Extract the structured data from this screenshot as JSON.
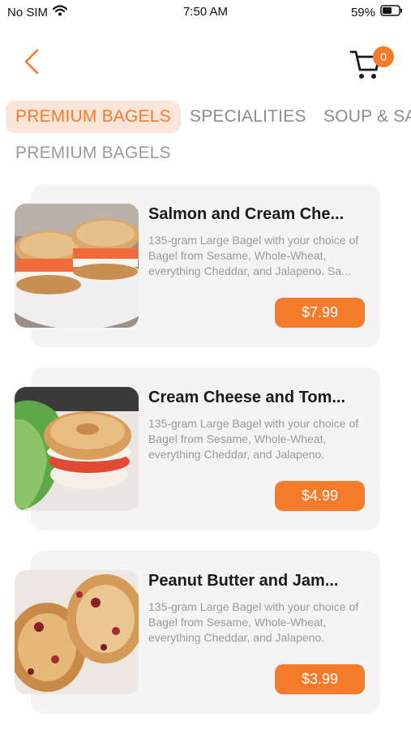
{
  "status_bar": {
    "carrier": "No SIM",
    "time": "7:50 AM",
    "battery": "59%"
  },
  "header": {
    "cart_count": "0"
  },
  "tabs": [
    {
      "label": "PREMIUM BAGELS",
      "active": true
    },
    {
      "label": "SPECIALITIES",
      "active": false
    },
    {
      "label": "SOUP & SA",
      "active": false
    }
  ],
  "section_title": "PREMIUM BAGELS",
  "items": [
    {
      "name": "Salmon and Cream Che...",
      "description": "135-gram Large Bagel with your choice of Bagel from Sesame, Whole-Wheat, everything Cheddar, and Jalapeno. Sa...",
      "price": "$7.99"
    },
    {
      "name": "Cream Cheese and Tom...",
      "description": "135-gram Large Bagel with your choice of Bagel from Sesame, Whole-Wheat, everything Cheddar, and Jalapeno.",
      "price": "$4.99"
    },
    {
      "name": "Peanut Butter and Jam...",
      "description": "135-gram Large Bagel with your choice of Bagel from Sesame, Whole-Wheat, everything Cheddar, and Jalapeno.",
      "price": "$3.99"
    }
  ],
  "colors": {
    "accent": "#f47b2a",
    "active_tab_bg": "#fbe5d9",
    "card_bg": "#f4f4f5"
  },
  "icons": [
    "wifi-icon",
    "battery-icon",
    "back-chevron-icon",
    "cart-icon"
  ]
}
